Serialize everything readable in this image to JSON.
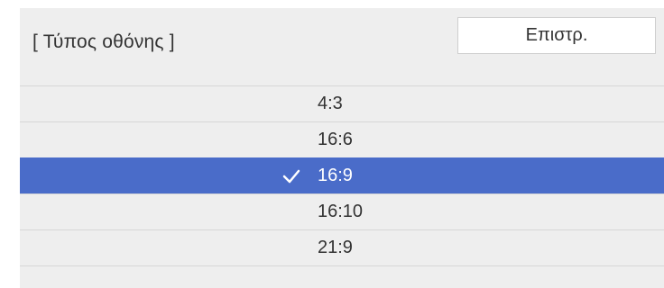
{
  "window": {
    "title": "[ Τύπος οθόνης ]",
    "back_label": "Επιστρ."
  },
  "options": [
    {
      "label": "4:3",
      "selected": false
    },
    {
      "label": "16:6",
      "selected": false
    },
    {
      "label": "16:9",
      "selected": true
    },
    {
      "label": "16:10",
      "selected": false
    },
    {
      "label": "21:9",
      "selected": false
    }
  ],
  "icons": {
    "selected_marker": "check-icon"
  },
  "colors": {
    "background": "#eeeeee",
    "selection": "#4a6cc9",
    "text": "#333333",
    "selected_text": "#ffffff"
  }
}
